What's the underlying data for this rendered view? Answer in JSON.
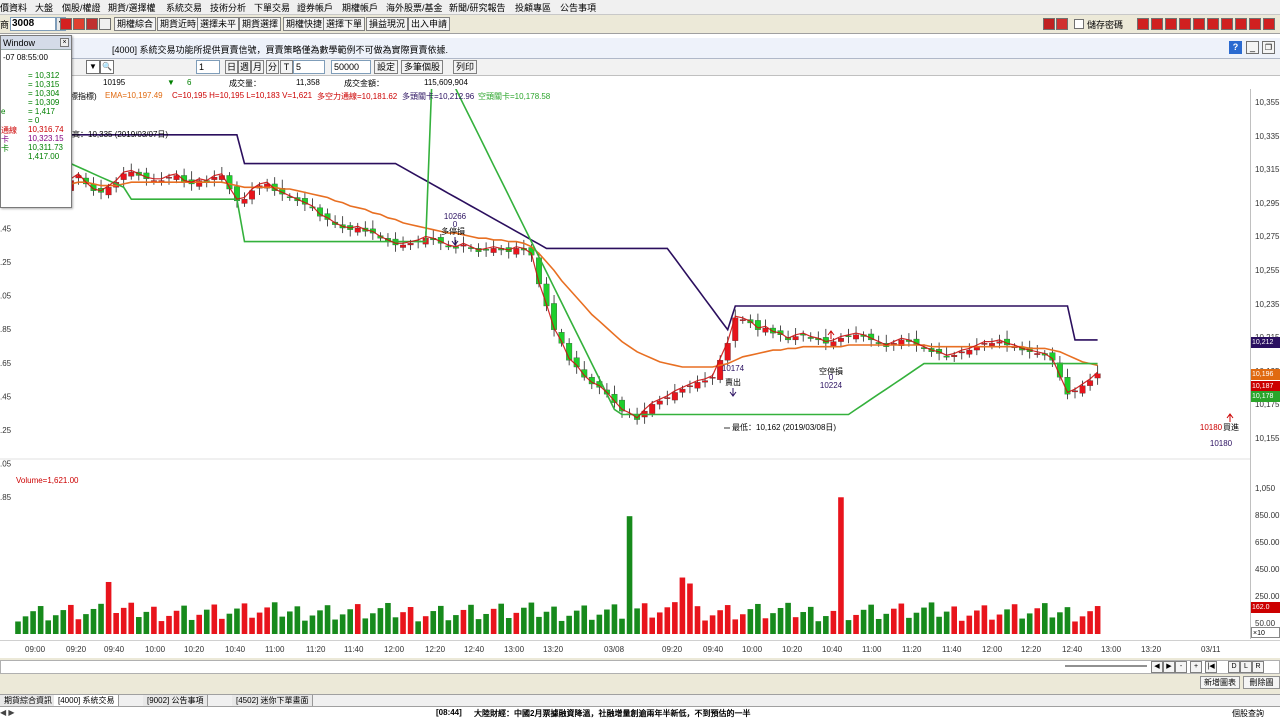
{
  "menu": {
    "items": [
      "價資料",
      "大盤",
      "個股/權證",
      "期貨/選擇權",
      "系統交易",
      "技術分析",
      "下單交易",
      "證券帳戶",
      "期權帳戶",
      "海外股票/基金",
      "新聞/研究報告",
      "投顧專區",
      "公告事項"
    ]
  },
  "toolbar1": {
    "prefix": "商",
    "symbol": "3008",
    "buttons": [
      "期權綜合",
      "期貨近時",
      "選擇未平",
      "期貨選擇",
      "期權快捷",
      "選擇下單",
      "損益現況",
      "出入申請"
    ],
    "save_password_label": "儲存密碼"
  },
  "infobar": {
    "window_title": "Window",
    "notice": "[4000] 系統交易功能所提供買賣信號，買賣策略僅為數學範例不可做為實際買賣依據."
  },
  "toolbar2": {
    "qty": "1",
    "periods": [
      "日",
      "週",
      "月",
      "分",
      "T"
    ],
    "period_value": "5",
    "count": "50000",
    "buttons": [
      "設定",
      "多筆個股",
      "列印"
    ]
  },
  "quote": {
    "price": "10195",
    "change_arrow": "▼",
    "change": "6",
    "volume_label": "成交量：",
    "volume": "11,358",
    "amount_label": "成交金額：",
    "amount": "115,609,904"
  },
  "indicator_line": {
    "prefix": "標指標)",
    "ema": "EMA=10,197.49",
    "ohlcv": "C=10,195 H=10,195 L=10,183 V=1,621",
    "pass_line": "多空力通線=10,181.62",
    "long_stop": "多頭關卡=10,212.96",
    "short_stop": "空頭關卡=10,178.58"
  },
  "float_window": {
    "title": "Window",
    "time_row": "-07  08:55:00",
    "rows": [
      {
        "label": "",
        "value": "= 10,312",
        "color": "#008000"
      },
      {
        "label": "",
        "value": "= 10,315",
        "color": "#008000"
      },
      {
        "label": "",
        "value": "= 10,304",
        "color": "#008000"
      },
      {
        "label": "",
        "value": "= 10,309",
        "color": "#008000"
      },
      {
        "label": "e",
        "value": "= 1,417",
        "color": "#008000"
      },
      {
        "label": "",
        "value": "= 0",
        "color": "#008000"
      },
      {
        "label": "通線",
        "value": "10,316.74",
        "color": "#cc0000"
      },
      {
        "label": "卡",
        "value": "10,323.15",
        "color": "#800080"
      },
      {
        "label": "卡",
        "value": "10,311.73",
        "color": "#008000"
      },
      {
        "label": "",
        "value": "1,417.00",
        "color": "#008000"
      }
    ]
  },
  "annotations": {
    "high": "高：10,335 (2019/03/07日)",
    "low": "最低：10,162 (2019/03/08日)",
    "a1_price": "10266",
    "a1_qty": "0",
    "a1_text": "多停損",
    "a2_price": "10174",
    "a2_text": "賣出",
    "a3_text": "空停損",
    "a3_qty": "0",
    "a3_price": "10224",
    "a4_price": "10180",
    "a4_text": "買進",
    "a4_price2": "10180"
  },
  "volume_label": "Volume=1,621.00",
  "price_axis": [
    "10,355",
    "10,335",
    "10,315",
    "10,295",
    "10,275",
    "10,255",
    "10,235",
    "10,215",
    "10,195",
    "10,175",
    "10,155"
  ],
  "volume_axis": [
    "1,050",
    "850.00",
    "650.00",
    "450.00",
    "250.00",
    "50.00"
  ],
  "left_axis": [
    ".25",
    ".05",
    ".85",
    ".65",
    ".45",
    ".25",
    ".05",
    ".85",
    ".65",
    ".45",
    ".25",
    ".05",
    ".85"
  ],
  "price_tags": [
    {
      "text": "10,212",
      "color": "#2a1060"
    },
    {
      "text": "10,196",
      "color": "#e06a10"
    },
    {
      "text": "10,187",
      "color": "#cc0000"
    },
    {
      "text": "10,178",
      "color": "#2aa52a"
    },
    {
      "text": "162.0",
      "color": "#cc0000"
    },
    {
      "text": "×10",
      "color": "#ffffff"
    }
  ],
  "time_axis": [
    "09:00",
    "09:20",
    "09:40",
    "10:00",
    "10:20",
    "10:40",
    "11:00",
    "11:20",
    "11:40",
    "12:00",
    "12:20",
    "12:40",
    "13:00",
    "13:20",
    "03/08",
    "09:20",
    "09:40",
    "10:00",
    "10:20",
    "10:40",
    "11:00",
    "11:20",
    "11:40",
    "12:00",
    "12:20",
    "12:40",
    "13:00",
    "13:20",
    "03/11"
  ],
  "bottom_buttons": [
    "新增圖表",
    "刪除圖"
  ],
  "nav_buttons": [
    "◀",
    "▶",
    "-",
    "+",
    "|◀",
    "D",
    "L",
    "R"
  ],
  "tabs": [
    "期貨綜合資訊",
    "[4000] 系統交易",
    "[9002] 公告事項",
    "[4502] 迷你下單畫面"
  ],
  "news": {
    "time": "[08:44]",
    "text": "大陸財經：中國2月票據融資降溫，社融增量創逾兩年半新低，不到預估的一半",
    "right_btn": "個股查詢"
  },
  "colors": {
    "up": "#e8141c",
    "down": "#1ecf2b",
    "ema": "#e86f22",
    "long_stop": "#2b0f5e",
    "short_stop": "#34b13c",
    "pass_line": "#cc1010"
  },
  "chart_data": {
    "type": "candlestick",
    "title": "",
    "timeframe": "5-minute",
    "ylim": [
      10150,
      10360
    ],
    "volume_ylim": [
      0,
      1100
    ],
    "candles_count": 160,
    "annotated": {
      "high": 10335,
      "low": 10162,
      "sell_signal": 10174,
      "buy_signal": 10180,
      "short_stop": 10224,
      "long_stop": 10266
    },
    "close_series": [
      10330,
      10322,
      10318,
      10312,
      10308,
      10305,
      10300,
      10306,
      10309,
      10304,
      10300,
      10299,
      10302,
      10305,
      10310,
      10311,
      10309,
      10307,
      10306,
      10306,
      10308,
      10309,
      10305,
      10304,
      10306,
      10305,
      10308,
      10309,
      10301,
      10294,
      10295,
      10300,
      10303,
      10304,
      10300,
      10298,
      10296,
      10294,
      10292,
      10290,
      10285,
      10283,
      10280,
      10278,
      10277,
      10278,
      10276,
      10275,
      10272,
      10270,
      10268,
      10268,
      10269,
      10270,
      10272,
      10271,
      10269,
      10267,
      10266,
      10268,
      10266,
      10264,
      10265,
      10266,
      10265,
      10264,
      10266,
      10265,
      10262,
      10245,
      10232,
      10218,
      10210,
      10200,
      10196,
      10190,
      10186,
      10184,
      10180,
      10175,
      10170,
      10168,
      10165,
      10170,
      10174,
      10176,
      10178,
      10181,
      10183,
      10185,
      10187,
      10188,
      10190,
      10200,
      10210,
      10225,
      10224,
      10222,
      10218,
      10219,
      10216,
      10215,
      10212,
      10214,
      10215,
      10213,
      10212,
      10210,
      10211,
      10213,
      10214,
      10215,
      10214,
      10212,
      10210,
      10208,
      10210,
      10212,
      10211,
      10209,
      10207,
      10205,
      10204,
      10202,
      10203,
      10205,
      10206,
      10208,
      10210,
      10210,
      10211,
      10209,
      10208,
      10206,
      10205,
      10204,
      10203,
      10200,
      10190,
      10180,
      10182,
      10185,
      10188,
      10192
    ],
    "ema_series": [
      10332,
      10325,
      10318,
      10313,
      10309,
      10306,
      10304,
      10304,
      10305,
      10305,
      10304,
      10303,
      10303,
      10303,
      10304,
      10305,
      10305,
      10305,
      10305,
      10305,
      10305,
      10305,
      10305,
      10305,
      10305,
      10305,
      10305,
      10305,
      10304,
      10303,
      10302,
      10302,
      10302,
      10302,
      10302,
      10301,
      10301,
      10300,
      10299,
      10298,
      10297,
      10296,
      10294,
      10293,
      10291,
      10290,
      10289,
      10287,
      10286,
      10284,
      10283,
      10281,
      10280,
      10279,
      10278,
      10277,
      10276,
      10275,
      10275,
      10274,
      10273,
      10272,
      10272,
      10271,
      10271,
      10270,
      10270,
      10269,
      10267,
      10263,
      10258,
      10253,
      10247,
      10242,
      10237,
      10232,
      10227,
      10223,
      10219,
      10215,
      10211,
      10208,
      10205,
      10203,
      10201,
      10199,
      10198,
      10197,
      10196,
      10196,
      10196,
      10196,
      10196,
      10197,
      10198,
      10200,
      10202,
      10203,
      10204,
      10205,
      10206,
      10206,
      10207,
      10207,
      10208,
      10208,
      10208,
      10208,
      10208,
      10208,
      10209,
      10209,
      10209,
      10209,
      10209,
      10209,
      10209,
      10209,
      10209,
      10209,
      10209,
      10208,
      10208,
      10208,
      10208,
      10208,
      10208,
      10208,
      10208,
      10208,
      10208,
      10208,
      10208,
      10208,
      10207,
      10207,
      10207,
      10206,
      10205,
      10203,
      10201,
      10199,
      10198,
      10197
    ]
  }
}
